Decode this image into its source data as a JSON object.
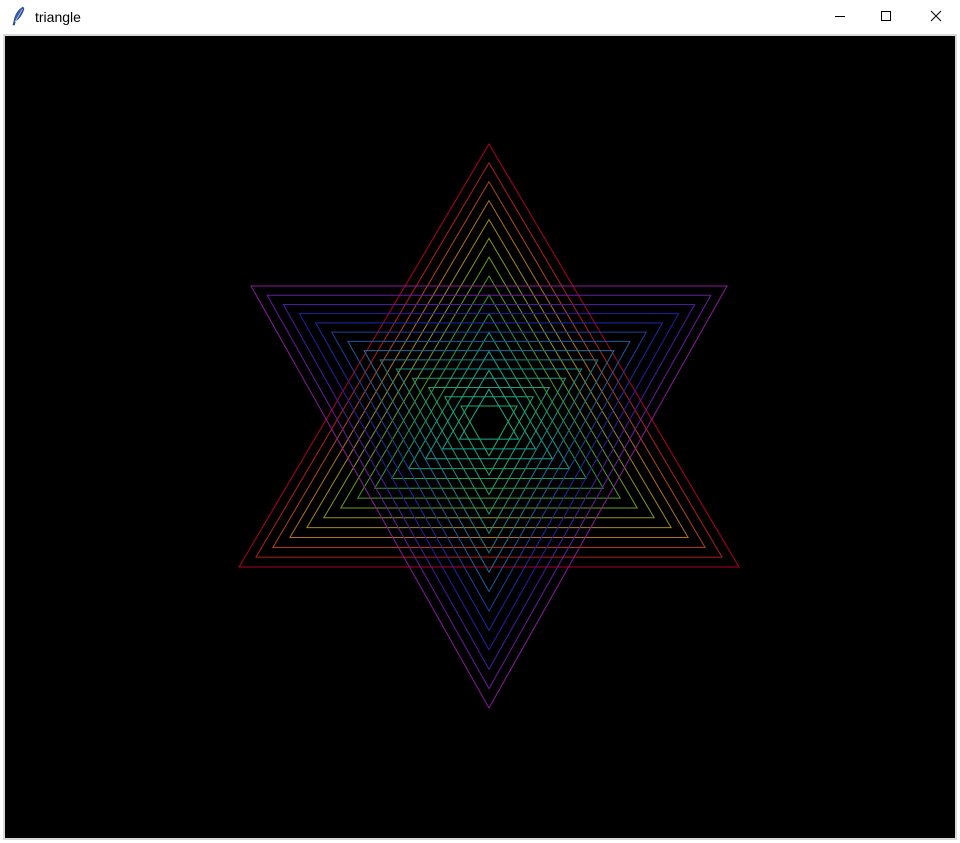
{
  "window": {
    "title": "triangle",
    "icon": "feather-icon",
    "controls": {
      "minimize_icon": "minimize-icon",
      "maximize_icon": "maximize-icon",
      "close_icon": "close-icon"
    }
  },
  "canvas": {
    "background": "#000000",
    "upward_triangle_colors": [
      "#b00020",
      "#b02018",
      "#b04418",
      "#b07018",
      "#a08a18",
      "#8c9418",
      "#6a9c18",
      "#4a9c20",
      "#2c9c30",
      "#1c9c50",
      "#16a070",
      "#14a48a",
      "#14a894",
      "#18ac98"
    ],
    "downward_triangle_colors": [
      "#8a1a9c",
      "#6a1aa0",
      "#4a1aa4",
      "#2a1aa8",
      "#1a2aa8",
      "#1a40a4",
      "#1a58a0",
      "#1a6c9c",
      "#1a7c94",
      "#1a8c8a",
      "#1a9880",
      "#1aa078",
      "#1aa870",
      "#1ab068"
    ]
  }
}
